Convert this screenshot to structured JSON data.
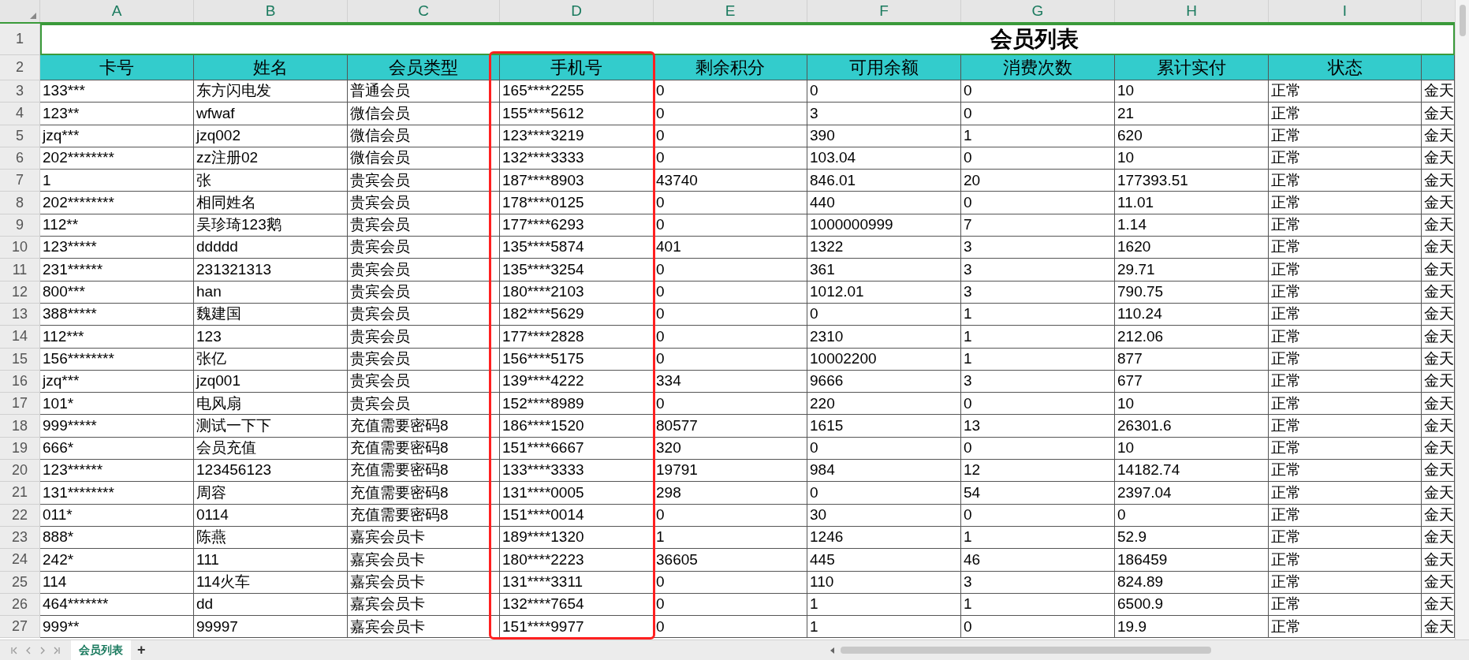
{
  "columns": [
    {
      "letter": "A",
      "highlighted": false
    },
    {
      "letter": "B",
      "highlighted": false
    },
    {
      "letter": "C",
      "highlighted": false
    },
    {
      "letter": "D",
      "highlighted": true
    },
    {
      "letter": "E",
      "highlighted": false
    },
    {
      "letter": "F",
      "highlighted": false
    },
    {
      "letter": "G",
      "highlighted": false
    },
    {
      "letter": "H",
      "highlighted": false
    },
    {
      "letter": "I",
      "highlighted": false
    }
  ],
  "title_row": {
    "number": "1",
    "title": "会员列表",
    "selected": true
  },
  "header_row": {
    "number": "2",
    "cells": [
      "卡号",
      "姓名",
      "会员类型",
      "手机号",
      "剩余积分",
      "可用余额",
      "消费次数",
      "累计实付",
      "状态"
    ]
  },
  "rows": [
    {
      "number": "3",
      "cells": [
        "133***",
        "东方闪电发",
        "普通会员",
        "165****2255",
        "0",
        "0",
        "0",
        "10",
        "正常",
        "金天"
      ]
    },
    {
      "number": "4",
      "cells": [
        "123**",
        "wfwaf",
        "微信会员",
        "155****5612",
        "0",
        "3",
        "0",
        "21",
        "正常",
        "金天"
      ]
    },
    {
      "number": "5",
      "cells": [
        "jzq***",
        "jzq002",
        "微信会员",
        "123****3219",
        "0",
        "390",
        "1",
        "620",
        "正常",
        "金天"
      ]
    },
    {
      "number": "6",
      "cells": [
        "202********",
        "zz注册02",
        "微信会员",
        "132****3333",
        "0",
        "103.04",
        "0",
        "10",
        "正常",
        "金天"
      ]
    },
    {
      "number": "7",
      "cells": [
        "1",
        "张",
        "贵宾会员",
        "187****8903",
        "43740",
        "846.01",
        "20",
        "177393.51",
        "正常",
        "金天"
      ]
    },
    {
      "number": "8",
      "cells": [
        "202********",
        "相同姓名",
        "贵宾会员",
        "178****0125",
        "0",
        "440",
        "0",
        "11.01",
        "正常",
        "金天"
      ]
    },
    {
      "number": "9",
      "cells": [
        "112**",
        "吴珍琦123鹅",
        "贵宾会员",
        "177****6293",
        "0",
        "1000000999",
        "7",
        "1.14",
        "正常",
        "金天"
      ]
    },
    {
      "number": "10",
      "cells": [
        "123*****",
        "ddddd",
        "贵宾会员",
        "135****5874",
        "401",
        "1322",
        "3",
        "1620",
        "正常",
        "金天"
      ]
    },
    {
      "number": "11",
      "cells": [
        "231******",
        "231321313",
        "贵宾会员",
        "135****3254",
        "0",
        "361",
        "3",
        "29.71",
        "正常",
        "金天"
      ]
    },
    {
      "number": "12",
      "cells": [
        "800***",
        "han",
        "贵宾会员",
        "180****2103",
        "0",
        "1012.01",
        "3",
        "790.75",
        "正常",
        "金天"
      ]
    },
    {
      "number": "13",
      "cells": [
        "388*****",
        "魏建国",
        "贵宾会员",
        "182****5629",
        "0",
        "0",
        "1",
        "110.24",
        "正常",
        "金天"
      ]
    },
    {
      "number": "14",
      "cells": [
        "112***",
        "123",
        "贵宾会员",
        "177****2828",
        "0",
        "2310",
        "1",
        "212.06",
        "正常",
        "金天"
      ]
    },
    {
      "number": "15",
      "cells": [
        "156********",
        "张亿",
        "贵宾会员",
        "156****5175",
        "0",
        "10002200",
        "1",
        "877",
        "正常",
        "金天"
      ]
    },
    {
      "number": "16",
      "cells": [
        "jzq***",
        "jzq001",
        "贵宾会员",
        "139****4222",
        "334",
        "9666",
        "3",
        "677",
        "正常",
        "金天"
      ]
    },
    {
      "number": "17",
      "cells": [
        "101*",
        "电风扇",
        "贵宾会员",
        "152****8989",
        "0",
        "220",
        "0",
        "10",
        "正常",
        "金天"
      ]
    },
    {
      "number": "18",
      "cells": [
        "999*****",
        "测试一下下",
        "充值需要密码8",
        "186****1520",
        "80577",
        "1615",
        "13",
        "26301.6",
        "正常",
        "金天"
      ]
    },
    {
      "number": "19",
      "cells": [
        "666*",
        "会员充值",
        "充值需要密码8",
        "151****6667",
        "320",
        "0",
        "0",
        "10",
        "正常",
        "金天"
      ]
    },
    {
      "number": "20",
      "cells": [
        "123******",
        "123456123",
        "充值需要密码8",
        "133****3333",
        "19791",
        "984",
        "12",
        "14182.74",
        "正常",
        "金天"
      ]
    },
    {
      "number": "21",
      "cells": [
        "131********",
        "周容",
        "充值需要密码8",
        "131****0005",
        "298",
        "0",
        "54",
        "2397.04",
        "正常",
        "金天"
      ]
    },
    {
      "number": "22",
      "cells": [
        "011*",
        "0114",
        "充值需要密码8",
        "151****0014",
        "0",
        "30",
        "0",
        "0",
        "正常",
        "金天"
      ]
    },
    {
      "number": "23",
      "cells": [
        "888*",
        "陈燕",
        "嘉宾会员卡",
        "189****1320",
        "1",
        "1246",
        "1",
        "52.9",
        "正常",
        "金天"
      ]
    },
    {
      "number": "24",
      "cells": [
        "242*",
        "111",
        "嘉宾会员卡",
        "180****2223",
        "36605",
        "445",
        "46",
        "186459",
        "正常",
        "金天"
      ]
    },
    {
      "number": "25",
      "cells": [
        "114",
        "114火车",
        "嘉宾会员卡",
        "131****3311",
        "0",
        "110",
        "3",
        "824.89",
        "正常",
        "金天"
      ]
    },
    {
      "number": "26",
      "cells": [
        "464*******",
        "dd",
        "嘉宾会员卡",
        "132****7654",
        "0",
        "1",
        "1",
        "6500.9",
        "正常",
        "金天"
      ]
    },
    {
      "number": "27",
      "cells": [
        "999**",
        "99997",
        "嘉宾会员卡",
        "151****9977",
        "0",
        "1",
        "0",
        "19.9",
        "正常",
        "金天"
      ]
    }
  ],
  "sheet_tabs": [
    {
      "label": "会员列表",
      "selected": true
    }
  ],
  "add_sheet_label": "+"
}
